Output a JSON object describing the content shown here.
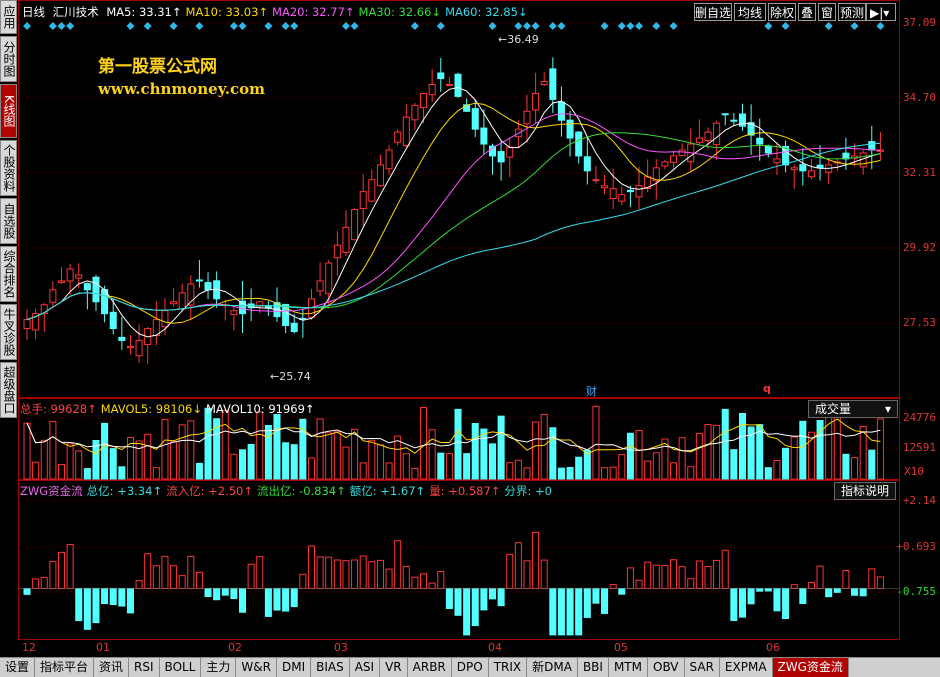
{
  "sidebar": {
    "tabs": [
      {
        "label": "应用",
        "active": false
      },
      {
        "label": "分时图",
        "active": false
      },
      {
        "label": "K线图",
        "active": true
      },
      {
        "label": "个股资料",
        "active": false
      },
      {
        "label": "自选股",
        "active": false
      },
      {
        "label": "综合排名",
        "active": false
      },
      {
        "label": "牛叉诊股",
        "active": false
      },
      {
        "label": "超级盘口",
        "active": false
      }
    ]
  },
  "header": {
    "period": "日线",
    "stock_name": "汇川技术",
    "ma": [
      {
        "text": "MA5: 33.31↑",
        "color": "#ffffff"
      },
      {
        "text": "MA10: 33.03↑",
        "color": "#ffd700"
      },
      {
        "text": "MA20: 32.77↑",
        "color": "#ff55ff"
      },
      {
        "text": "MA30: 32.66↓",
        "color": "#33dd33"
      },
      {
        "text": "MA60: 32.85↓",
        "color": "#33ddee"
      }
    ],
    "buttons": [
      "删自选",
      "均线",
      "除权",
      "叠",
      "窗",
      "预测"
    ]
  },
  "watermark": {
    "line1": "第一股票公式网",
    "line2": "www.chnmoney.com"
  },
  "annotations": {
    "high": "36.49",
    "low": "25.74",
    "cai": "财",
    "q": "q"
  },
  "price_axis": [
    "37.09",
    "34.70",
    "32.31",
    "29.92",
    "27.53"
  ],
  "volume": {
    "legend": [
      {
        "text": "总手: 99628↑",
        "color": "#ff4444"
      },
      {
        "text": "MAVOL5: 98106↓",
        "color": "#ffd700"
      },
      {
        "text": "MAVOL10: 91969↑",
        "color": "#ffffff"
      }
    ],
    "selector": "成交量",
    "axis": [
      "24776",
      "12591"
    ],
    "unit": "X10"
  },
  "indicator": {
    "legend": [
      {
        "text": "ZWG资金流",
        "color": "#ee66ee"
      },
      {
        "text": "总亿: +3.34↑",
        "color": "#33dddd"
      },
      {
        "text": "流入亿: +2.50↑",
        "color": "#ff4444"
      },
      {
        "text": "流出亿: -0.834↑",
        "color": "#33dd33"
      },
      {
        "text": "额亿: +1.67↑",
        "color": "#33dddd"
      },
      {
        "text": "量: +0.587↑",
        "color": "#ff4444"
      },
      {
        "text": "分界: +0",
        "color": "#33dddd"
      }
    ],
    "button": "指标说明",
    "axis": [
      "+2.14",
      "+0.693",
      "-0.755"
    ]
  },
  "x_axis": [
    "12",
    "01",
    "02",
    "03",
    "04",
    "05",
    "06"
  ],
  "bottom_tabs": [
    "设置",
    "指标平台",
    "资讯",
    "RSI",
    "BOLL",
    "主力",
    "W&R",
    "DMI",
    "BIAS",
    "ASI",
    "VR",
    "ARBR",
    "DPO",
    "TRIX",
    "新DMA",
    "BBI",
    "MTM",
    "OBV",
    "SAR",
    "EXPMA",
    "ZWG资金流"
  ],
  "active_bottom_tab": "ZWG资金流",
  "colors": {
    "up": "#ff3333",
    "down": "#54ffff",
    "frame": "#a00000"
  },
  "chart_data": {
    "type": "candlestick",
    "price_range": [
      25.0,
      37.6
    ],
    "closes": [
      27.6,
      27.8,
      28.1,
      28.6,
      28.9,
      29.3,
      29.1,
      28.6,
      28.2,
      27.8,
      27.3,
      26.9,
      26.7,
      26.9,
      27.3,
      27.6,
      27.9,
      28.2,
      28.5,
      28.8,
      28.9,
      28.6,
      28.3,
      28.1,
      27.9,
      27.8,
      28.0,
      28.2,
      28.0,
      27.7,
      27.4,
      27.2,
      27.6,
      28.3,
      28.9,
      29.5,
      30.1,
      30.7,
      31.3,
      31.9,
      32.3,
      32.8,
      33.3,
      33.9,
      34.4,
      34.8,
      35.2,
      35.5,
      35.7,
      35.5,
      35.1,
      34.6,
      34.0,
      33.5,
      33.1,
      32.9,
      33.4,
      34.0,
      34.6,
      35.2,
      35.6,
      35.0,
      34.3,
      33.7,
      33.1,
      32.6,
      32.3,
      32.1,
      32.0,
      31.8,
      31.9,
      32.1,
      32.4,
      32.7,
      32.9,
      33.1,
      33.3,
      33.5,
      33.7,
      33.9,
      34.2,
      34.5,
      34.3,
      34.1,
      33.8,
      33.5,
      33.2,
      33.0,
      32.8,
      32.7,
      32.6,
      32.6,
      32.7,
      32.8,
      32.9,
      33.0,
      33.1,
      33.2,
      33.3,
      33.3
    ],
    "volume_ma_range": [
      0,
      30000
    ],
    "fund_flow_range": [
      -1.6,
      2.6
    ]
  }
}
